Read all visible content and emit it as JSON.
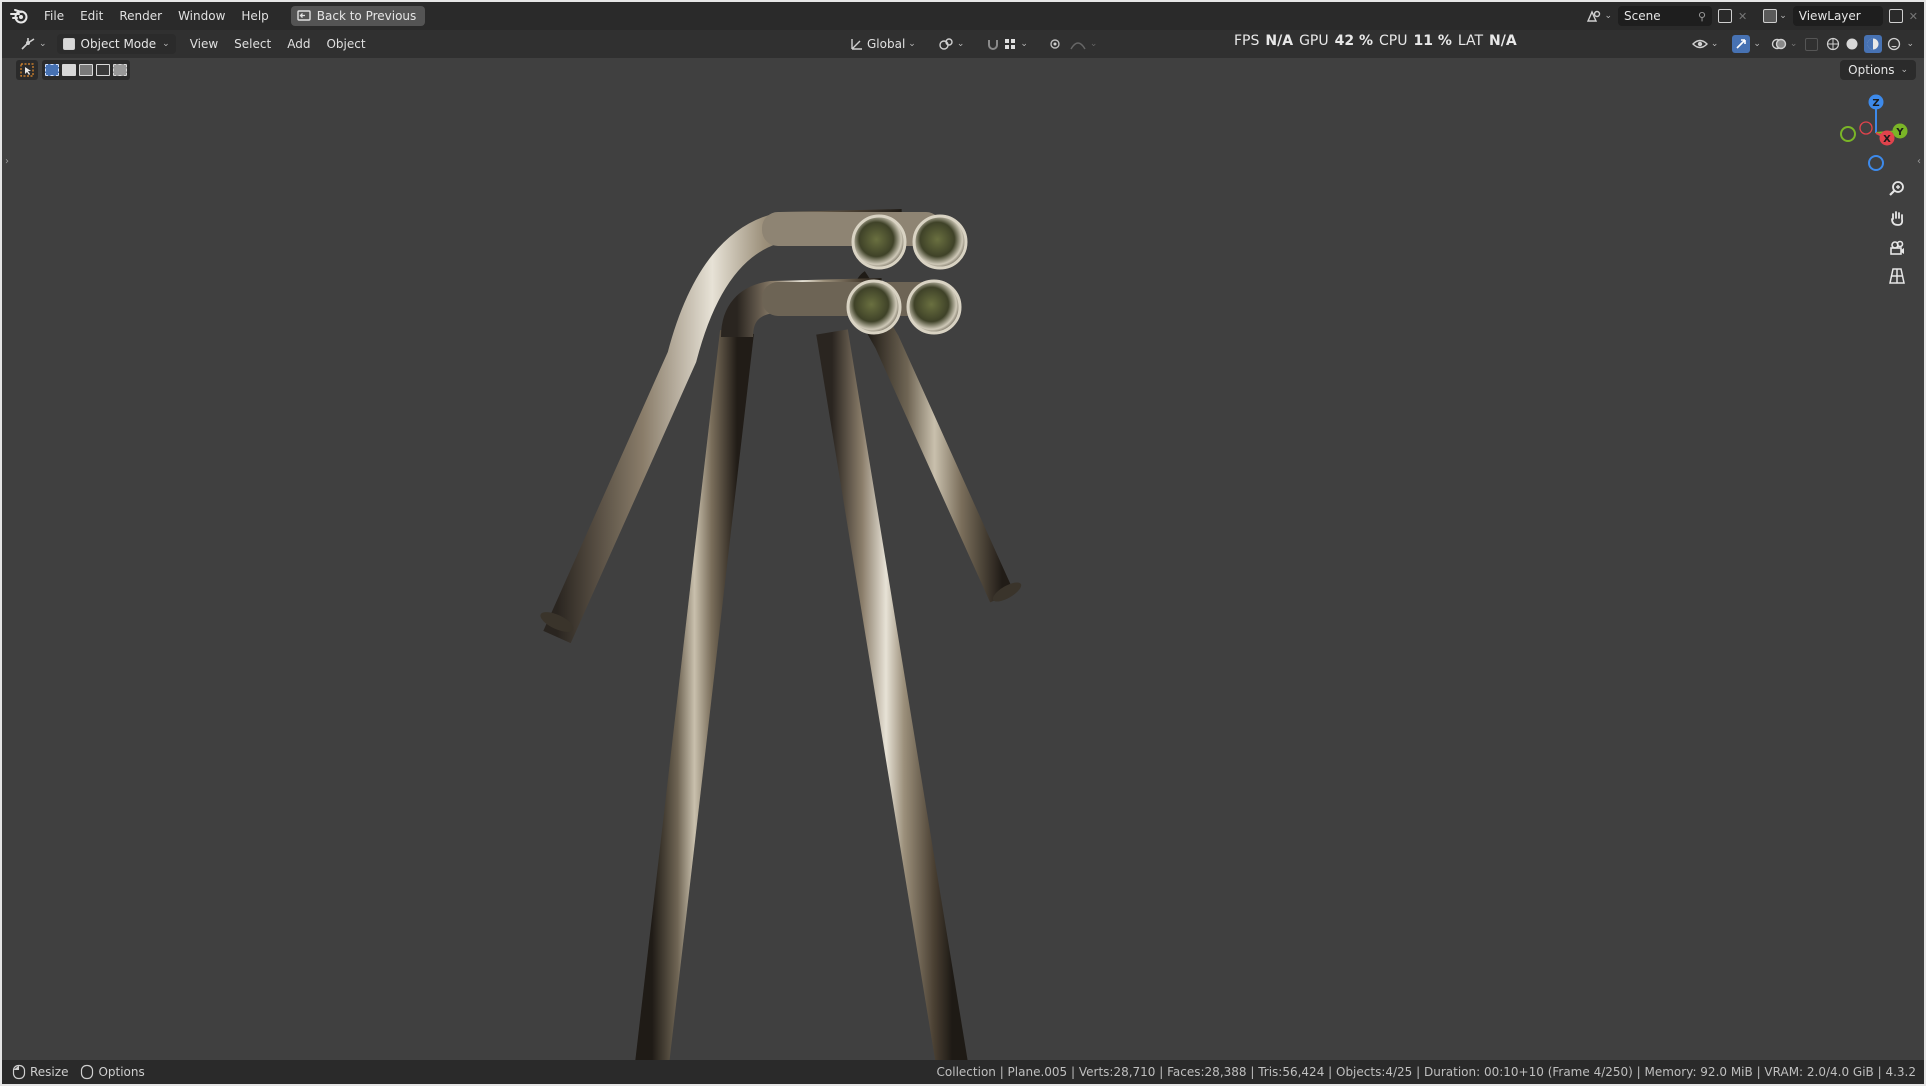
{
  "menubar": {
    "items": [
      "File",
      "Edit",
      "Render",
      "Window",
      "Help"
    ],
    "back_button": "Back to Previous",
    "scene_name": "Scene",
    "view_layer": "ViewLayer"
  },
  "header": {
    "mode": "Object Mode",
    "menus": [
      "View",
      "Select",
      "Add",
      "Object"
    ],
    "orientation": "Global",
    "options_label": "Options"
  },
  "stats": {
    "fps_label": "FPS",
    "fps_value": "N/A",
    "gpu_label": "GPU",
    "gpu_value": "42 %",
    "cpu_label": "CPU",
    "cpu_value": "11 %",
    "lat_label": "LAT",
    "lat_value": "N/A"
  },
  "gizmo": {
    "x": "X",
    "y": "Y",
    "z": "Z"
  },
  "statusbar": {
    "left": [
      "Resize",
      "Options"
    ],
    "info": "Collection | Plane.005 | Verts:28,710 | Faces:28,388 | Tris:56,424 | Objects:4/25 | Duration: 00:10+10 (Frame 4/250) | Memory: 92.0 MiB | VRAM: 2.0/4.0 GiB | 4.3.2"
  },
  "colors": {
    "accent": "#4772b3",
    "axis_x": "#e0434c",
    "axis_y": "#7ab527",
    "axis_z": "#3d8aeb"
  }
}
